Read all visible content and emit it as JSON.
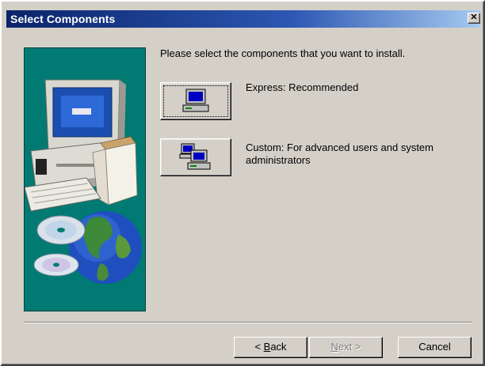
{
  "window": {
    "title": "Select Components",
    "close_glyph": "✕"
  },
  "main": {
    "instruction": "Please select the components that you want to install.",
    "options": [
      {
        "label": "Express: Recommended",
        "icon": "single-computer-icon"
      },
      {
        "label": "Custom: For advanced users and system administrators",
        "icon": "networked-computers-icon"
      }
    ],
    "art": "computer-with-box-cds-and-globe-illustration"
  },
  "buttons": {
    "back": {
      "prefix": "< ",
      "key": "B",
      "rest": "ack"
    },
    "next": {
      "key": "N",
      "rest": "ext >",
      "enabled": false
    },
    "cancel": "Cancel"
  },
  "colors": {
    "titlebar_start": "#0a246a",
    "titlebar_end": "#a6caf0",
    "dialog_face": "#d4d0c8",
    "art_background": "#007a72"
  }
}
